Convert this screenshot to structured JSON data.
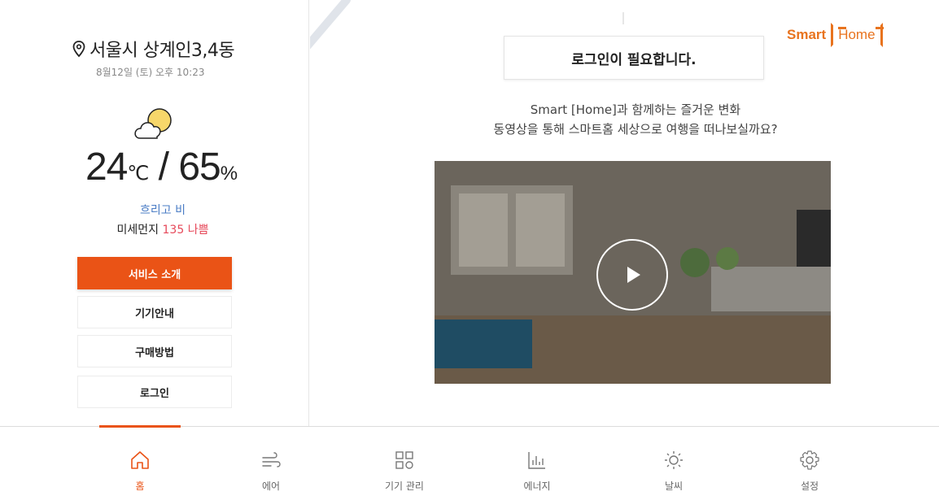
{
  "location": {
    "name": "서울시 상계인3,4동",
    "datetime": "8월12일 (토) 오후 10:23"
  },
  "weather": {
    "temperature": "24",
    "temp_unit": "℃",
    "separator": " / ",
    "humidity": "65",
    "humidity_unit": "%",
    "condition": "흐리고 비",
    "dust_label": "미세먼지",
    "dust_value": "135 나쁨",
    "icon": "cloud-sun-icon"
  },
  "menu": {
    "items": [
      {
        "label": "서비스 소개",
        "active": true
      },
      {
        "label": "기기안내",
        "active": false
      },
      {
        "label": "구매방법",
        "active": false
      },
      {
        "label": "로그인",
        "active": false
      }
    ]
  },
  "main": {
    "login_notice": "로그인이 필요합니다.",
    "promo_line1": "Smart [Home]과 함께하는 즐거운 변화",
    "promo_line2": "동영상을 통해 스마트홈 세상으로 여행을 떠나보실까요?",
    "logo_text": "Smart",
    "logo_box_text": "Home"
  },
  "nav": {
    "items": [
      {
        "label": "홈",
        "icon": "home-icon",
        "active": true
      },
      {
        "label": "에어",
        "icon": "wind-icon",
        "active": false
      },
      {
        "label": "기기 관리",
        "icon": "device-icon",
        "active": false
      },
      {
        "label": "에너지",
        "icon": "energy-chart-icon",
        "active": false
      },
      {
        "label": "날씨",
        "icon": "sun-icon",
        "active": false
      },
      {
        "label": "설정",
        "icon": "gear-icon",
        "active": false
      }
    ]
  },
  "colors": {
    "accent": "#ea5316",
    "logo": "#e8731e",
    "weather_text": "#4a7cc5",
    "dust_bad": "#e6495a"
  }
}
